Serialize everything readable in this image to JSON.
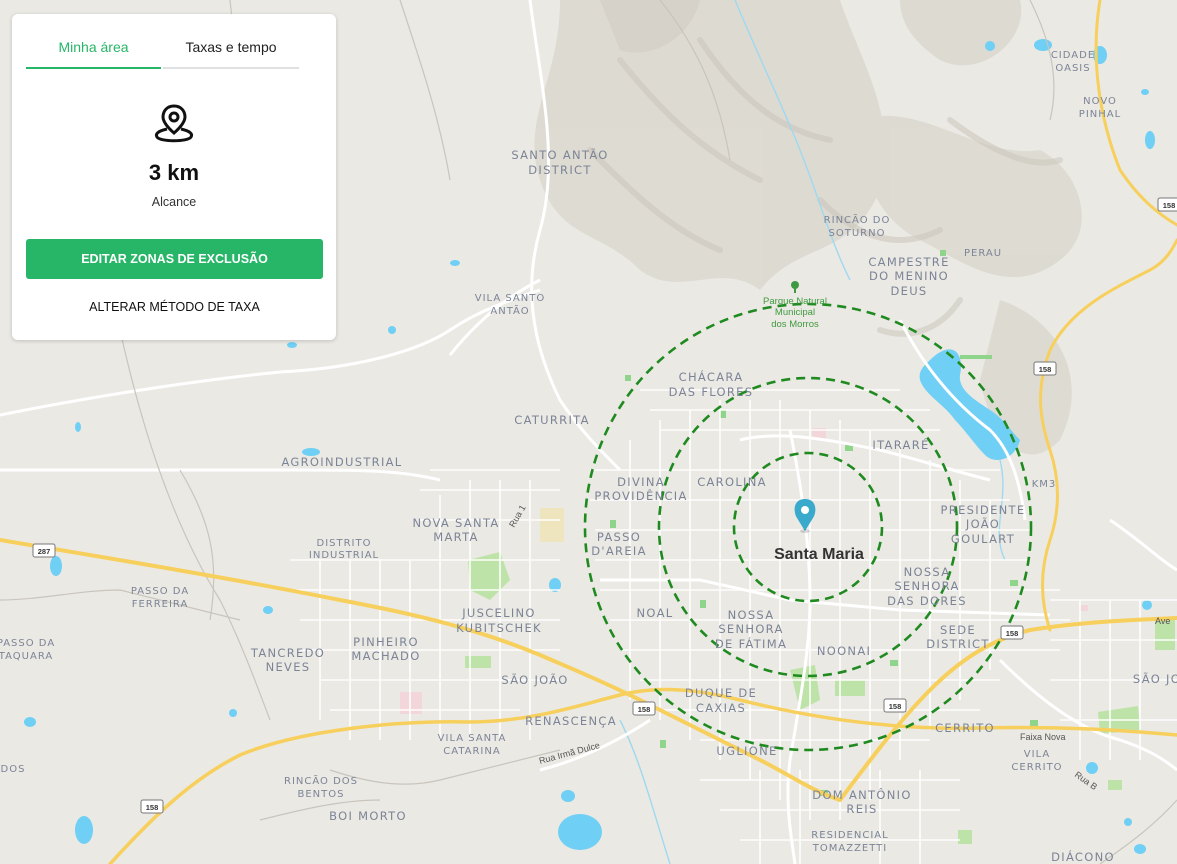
{
  "panel": {
    "tabs": [
      "Minha área",
      "Taxas e tempo"
    ],
    "range_value": "3 km",
    "range_label": "Alcance",
    "edit_button": "EDITAR ZONAS DE EXCLUSÃO",
    "change_link": "ALTERAR MÉTODO DE TAXA"
  },
  "map": {
    "city": "Santa Maria",
    "park": [
      "Parque Natural",
      "Municipal",
      "dos Morros"
    ],
    "neighborhoods": {
      "santo_antao": [
        "SANTO ANTÃO",
        "DISTRICT"
      ],
      "vila_santo_antao": [
        "VILA SANTO",
        "ANTÃO"
      ],
      "rincao_do_soturno": [
        "RINCÃO DO",
        "SOTURNO"
      ],
      "campestre": [
        "CAMPESTRE",
        "DO MENINO",
        "DEUS"
      ],
      "perau": "PERAU",
      "cidade_oasis": [
        "CIDADE",
        "OASIS"
      ],
      "novo_pinhal": [
        "NOVO",
        "PINHAL"
      ],
      "chacara": [
        "CHÁCARA",
        "DAS FLORES"
      ],
      "caturrita": "CATURRITA",
      "itarare": "ITARARÉ",
      "km3": "KM3",
      "agroindustrial": "AGROINDUSTRIAL",
      "divina": [
        "DIVINA",
        "PROVIDÊNCIA"
      ],
      "carolina": "CAROLINA",
      "presidente": [
        "PRESIDENTE",
        "JOÃO",
        "GOULART"
      ],
      "nova_santa_marta": [
        "NOVA SANTA",
        "MARTA"
      ],
      "distrito_industrial": [
        "DISTRITO",
        "INDUSTRIAL"
      ],
      "passo_dareia": [
        "PASSO",
        "D'AREIA"
      ],
      "nossa_dores": [
        "NOSSA",
        "SENHORA",
        "DAS DORES"
      ],
      "passo_ferreira": [
        "PASSO DA",
        "FERREIRA"
      ],
      "juscelino": [
        "JUSCELINO",
        "KUBITSCHEK"
      ],
      "noal": "NOAL",
      "nossa_fatima": [
        "NOSSA",
        "SENHORA",
        "DE FÁTIMA"
      ],
      "sede_district": [
        "SEDE",
        "DISTRICT"
      ],
      "passo_taquara": [
        "PASSO DA",
        "TAQUARA"
      ],
      "tancredo": [
        "TANCREDO",
        "NEVES"
      ],
      "pinheiro": [
        "PINHEIRO",
        "MACHADO"
      ],
      "noonai": "NOONAI",
      "sao_joao": "SÃO JOÃO",
      "sao_jo_right": "SÃO JO",
      "duque": [
        "DUQUE DE",
        "CAXIAS"
      ],
      "renascenca": "RENASCENÇA",
      "cerrito": "CERRITO",
      "vila_santa_catarina": [
        "VILA SANTA",
        "CATARINA"
      ],
      "ugulione": "UGLIONE",
      "vila_cerrito": [
        "VILA",
        "CERRITO"
      ],
      "dos": "DOS",
      "rincao_dos_bentos": [
        "RINCÃO DOS",
        "BENTOS"
      ],
      "dom_antonio": [
        "DOM ANTÔNIO",
        "REIS"
      ],
      "boi_morto": "BOI MORTO",
      "residencial": [
        "RESIDENCIAL",
        "TOMAZZETTI"
      ],
      "diacono": "DIÁCONO"
    },
    "roads": {
      "rua1": "Rua 1",
      "rua_irma_dulce": "Rua Irmã Dulce",
      "faixa_nova": "Faixa Nova",
      "rua_b": "Rua B",
      "ave": "Ave"
    },
    "shields": {
      "s287": "287",
      "s158": "158"
    },
    "colors": {
      "accent": "#27b567",
      "radius": "#1f8a1f",
      "water": "#6fcff4",
      "road_major": "#f7cf5c",
      "pin": "#39a9cc"
    }
  }
}
